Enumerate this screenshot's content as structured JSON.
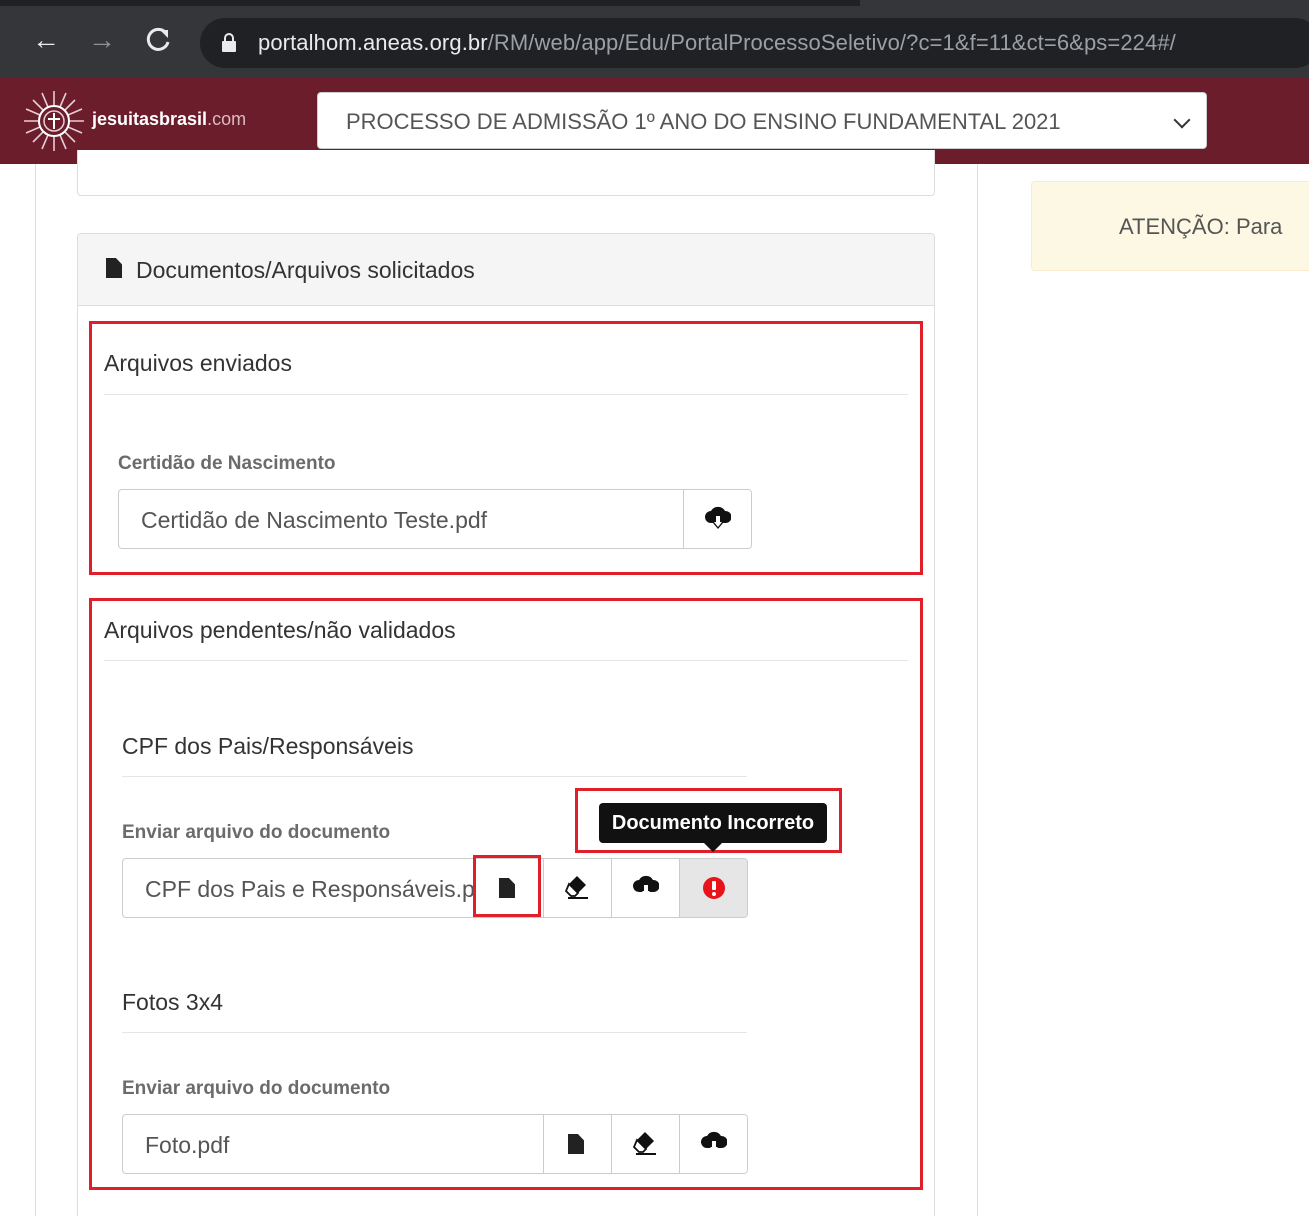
{
  "browser": {
    "url_host": "portalhom.aneas.org.br",
    "url_path": "/RM/web/app/Edu/PortalProcessoSeletivo/?c=1&f=11&ct=6&ps=224#/"
  },
  "header": {
    "logo_name": "jesuitasbrasil",
    "logo_domain": ".com",
    "process_select_value": "PROCESSO DE ADMISSÃO 1º ANO DO ENSINO FUNDAMENTAL 2021"
  },
  "alert": {
    "text": "ATENÇÃO: Para"
  },
  "documents_panel": {
    "title": "Documentos/Arquivos solicitados",
    "sent": {
      "title": "Arquivos enviados",
      "label": "Certidão de Nascimento",
      "file_value": "Certidão de Nascimento Teste.pdf"
    },
    "pending": {
      "title": "Arquivos pendentes/não validados",
      "items": [
        {
          "name": "CPF dos Pais/Responsáveis",
          "label": "Enviar arquivo do documento",
          "file_value": "CPF dos Pais e Responsáveis.pdf",
          "tooltip": "Documento Incorreto"
        },
        {
          "name": "Fotos 3x4",
          "label": "Enviar arquivo do documento",
          "file_value": "Foto.pdf"
        }
      ]
    }
  },
  "colors": {
    "header_bg": "#6b1d2c",
    "highlight_red": "#e01f2a",
    "error_icon": "#e8141c"
  }
}
